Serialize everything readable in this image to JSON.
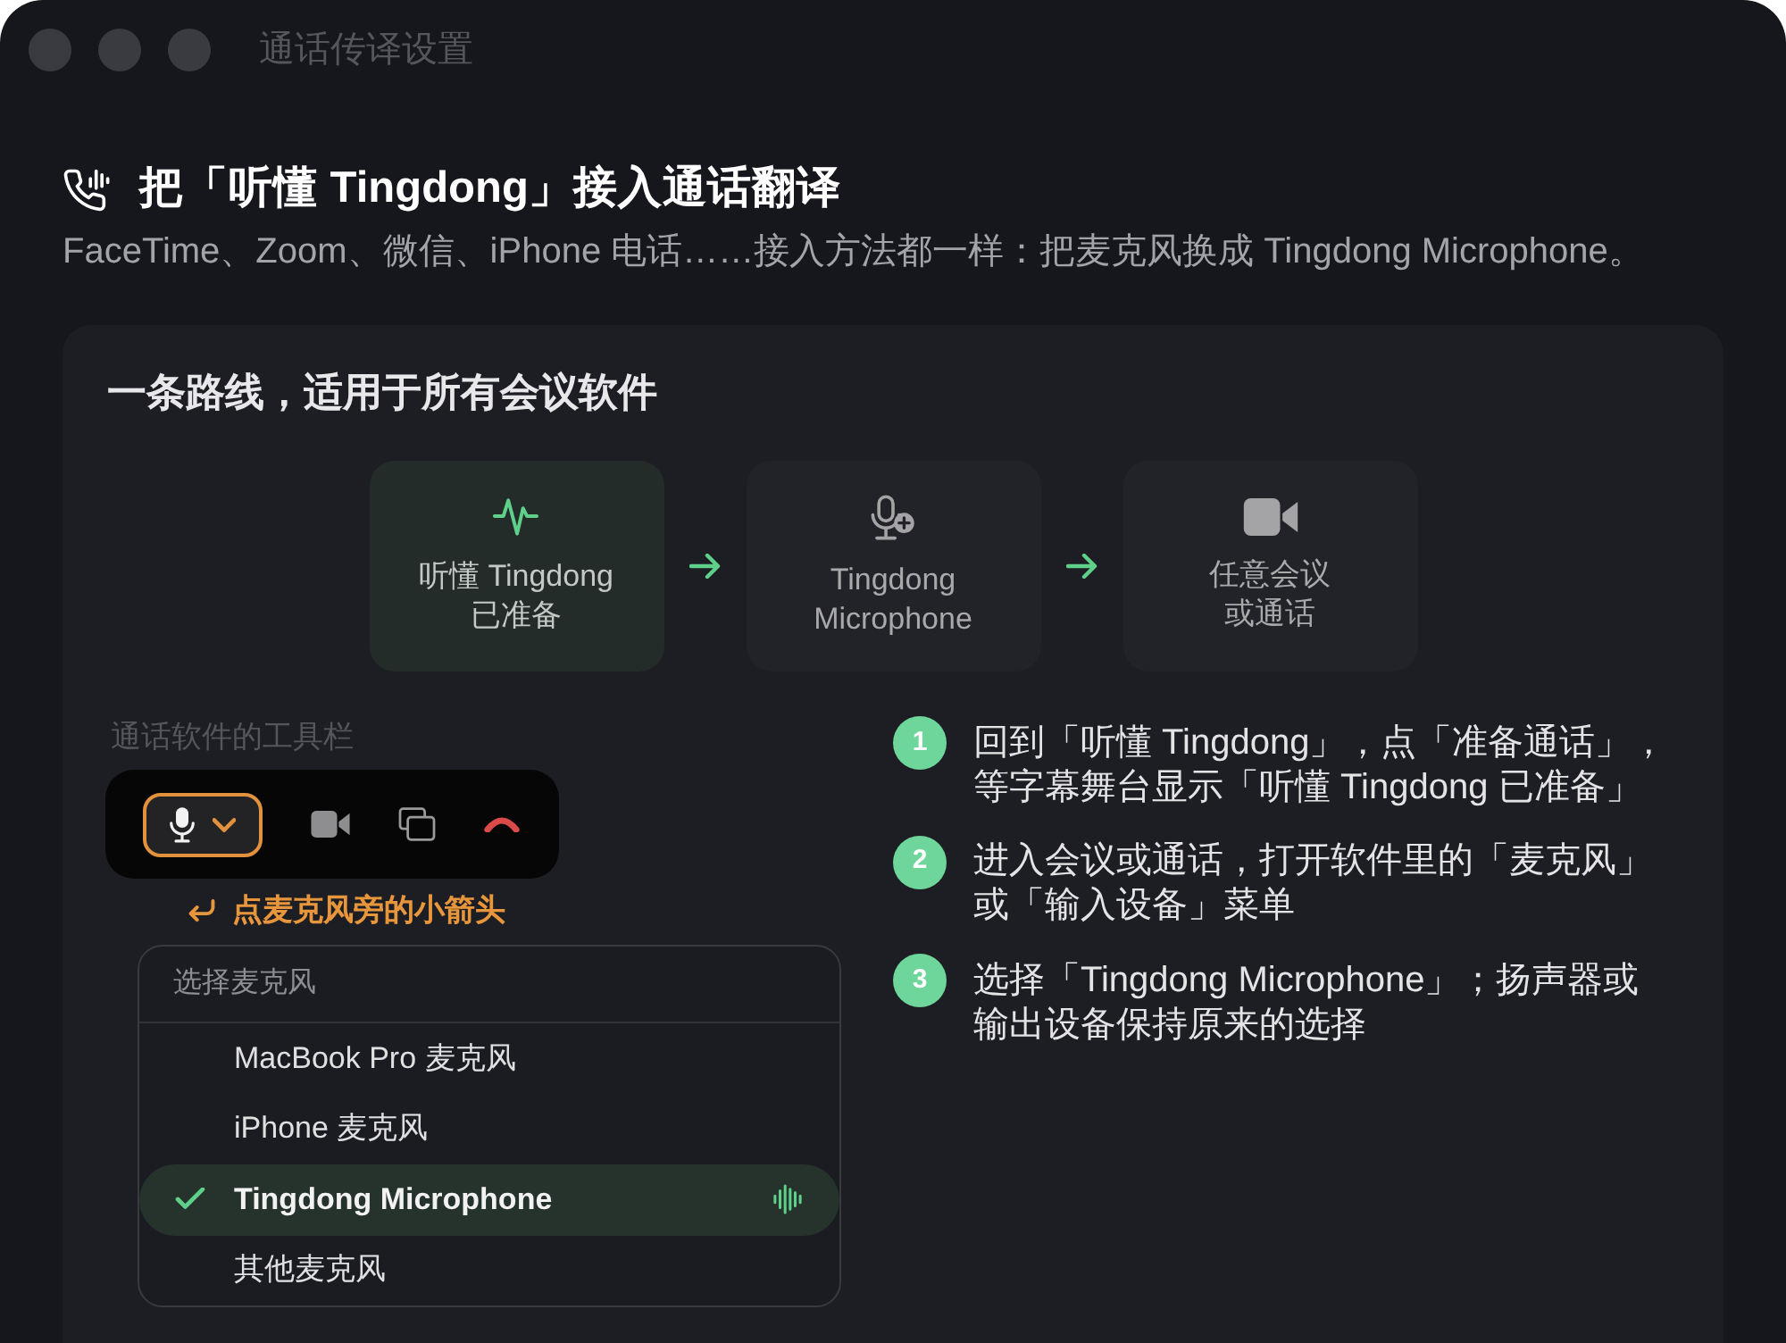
{
  "window": {
    "title": "通话传译设置"
  },
  "header": {
    "title": "把「听懂 Tingdong」接入通话翻译",
    "subtitle": "FaceTime、Zoom、微信、iPhone 电话……接入方法都一样：把麦克风换成 Tingdong Microphone。"
  },
  "route_card": {
    "title": "一条路线，适用于所有会议软件",
    "flow": [
      {
        "kind": "pulse",
        "label": "听懂 Tingdong 已准备",
        "active": true
      },
      {
        "kind": "microphone",
        "label": "Tingdong Microphone",
        "active": false
      },
      {
        "kind": "video",
        "label": "任意会议或通话",
        "active": false
      }
    ],
    "toolbar": {
      "label": "通话软件的工具栏",
      "buttons": [
        {
          "kind": "microphone",
          "highlighted": true
        },
        {
          "kind": "video",
          "highlighted": false
        },
        {
          "kind": "screens",
          "highlighted": false
        },
        {
          "kind": "hang_up",
          "highlighted": false
        }
      ]
    },
    "hint": "点麦克风旁的小箭头",
    "menu": {
      "title": "选择麦克风",
      "items": [
        {
          "label": "MacBook Pro 麦克风",
          "selected": false
        },
        {
          "label": "iPhone 麦克风",
          "selected": false
        },
        {
          "label": "Tingdong Microphone",
          "selected": true
        },
        {
          "label": "其他麦克风",
          "selected": false
        }
      ]
    },
    "steps": [
      {
        "number": "1",
        "text": "回到「听懂 Tingdong」，点「准备通话」，等字幕舞台显示「听懂 Tingdong 已准备」"
      },
      {
        "number": "2",
        "text": "进入会议或通话，打开软件里的「麦克风」或「输入设备」菜单"
      },
      {
        "number": "3",
        "text": "选择「Tingdong Microphone」；扬声器或输出设备保持原来的选择"
      }
    ]
  }
}
